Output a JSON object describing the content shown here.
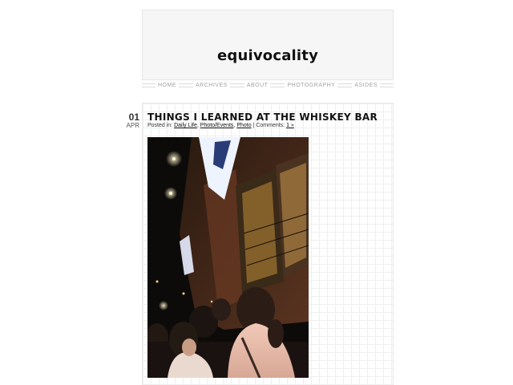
{
  "site": {
    "title": "equivocality"
  },
  "nav": {
    "items": [
      "HOME",
      "ARCHIVES",
      "ABOUT",
      "PHOTOGRAPHY",
      "ASIDES"
    ]
  },
  "post": {
    "date": {
      "day": "01",
      "month": "APR"
    },
    "title": "THINGS I LEARNED AT THE WHISKEY BAR",
    "meta": {
      "posted_in_label": "Posted in:",
      "categories": [
        "Daily Life",
        "Photo/Events",
        "Photo"
      ],
      "comments_label": "Comments:",
      "comments_link": "1 »"
    },
    "image": {
      "description_icon": "photo-of-crowd-outside-bar-at-night"
    }
  },
  "colors": {
    "header_bg": "#f6f6f6",
    "nav_text": "#a3a3a3",
    "title_text": "#111111",
    "grid": "#efefef"
  }
}
